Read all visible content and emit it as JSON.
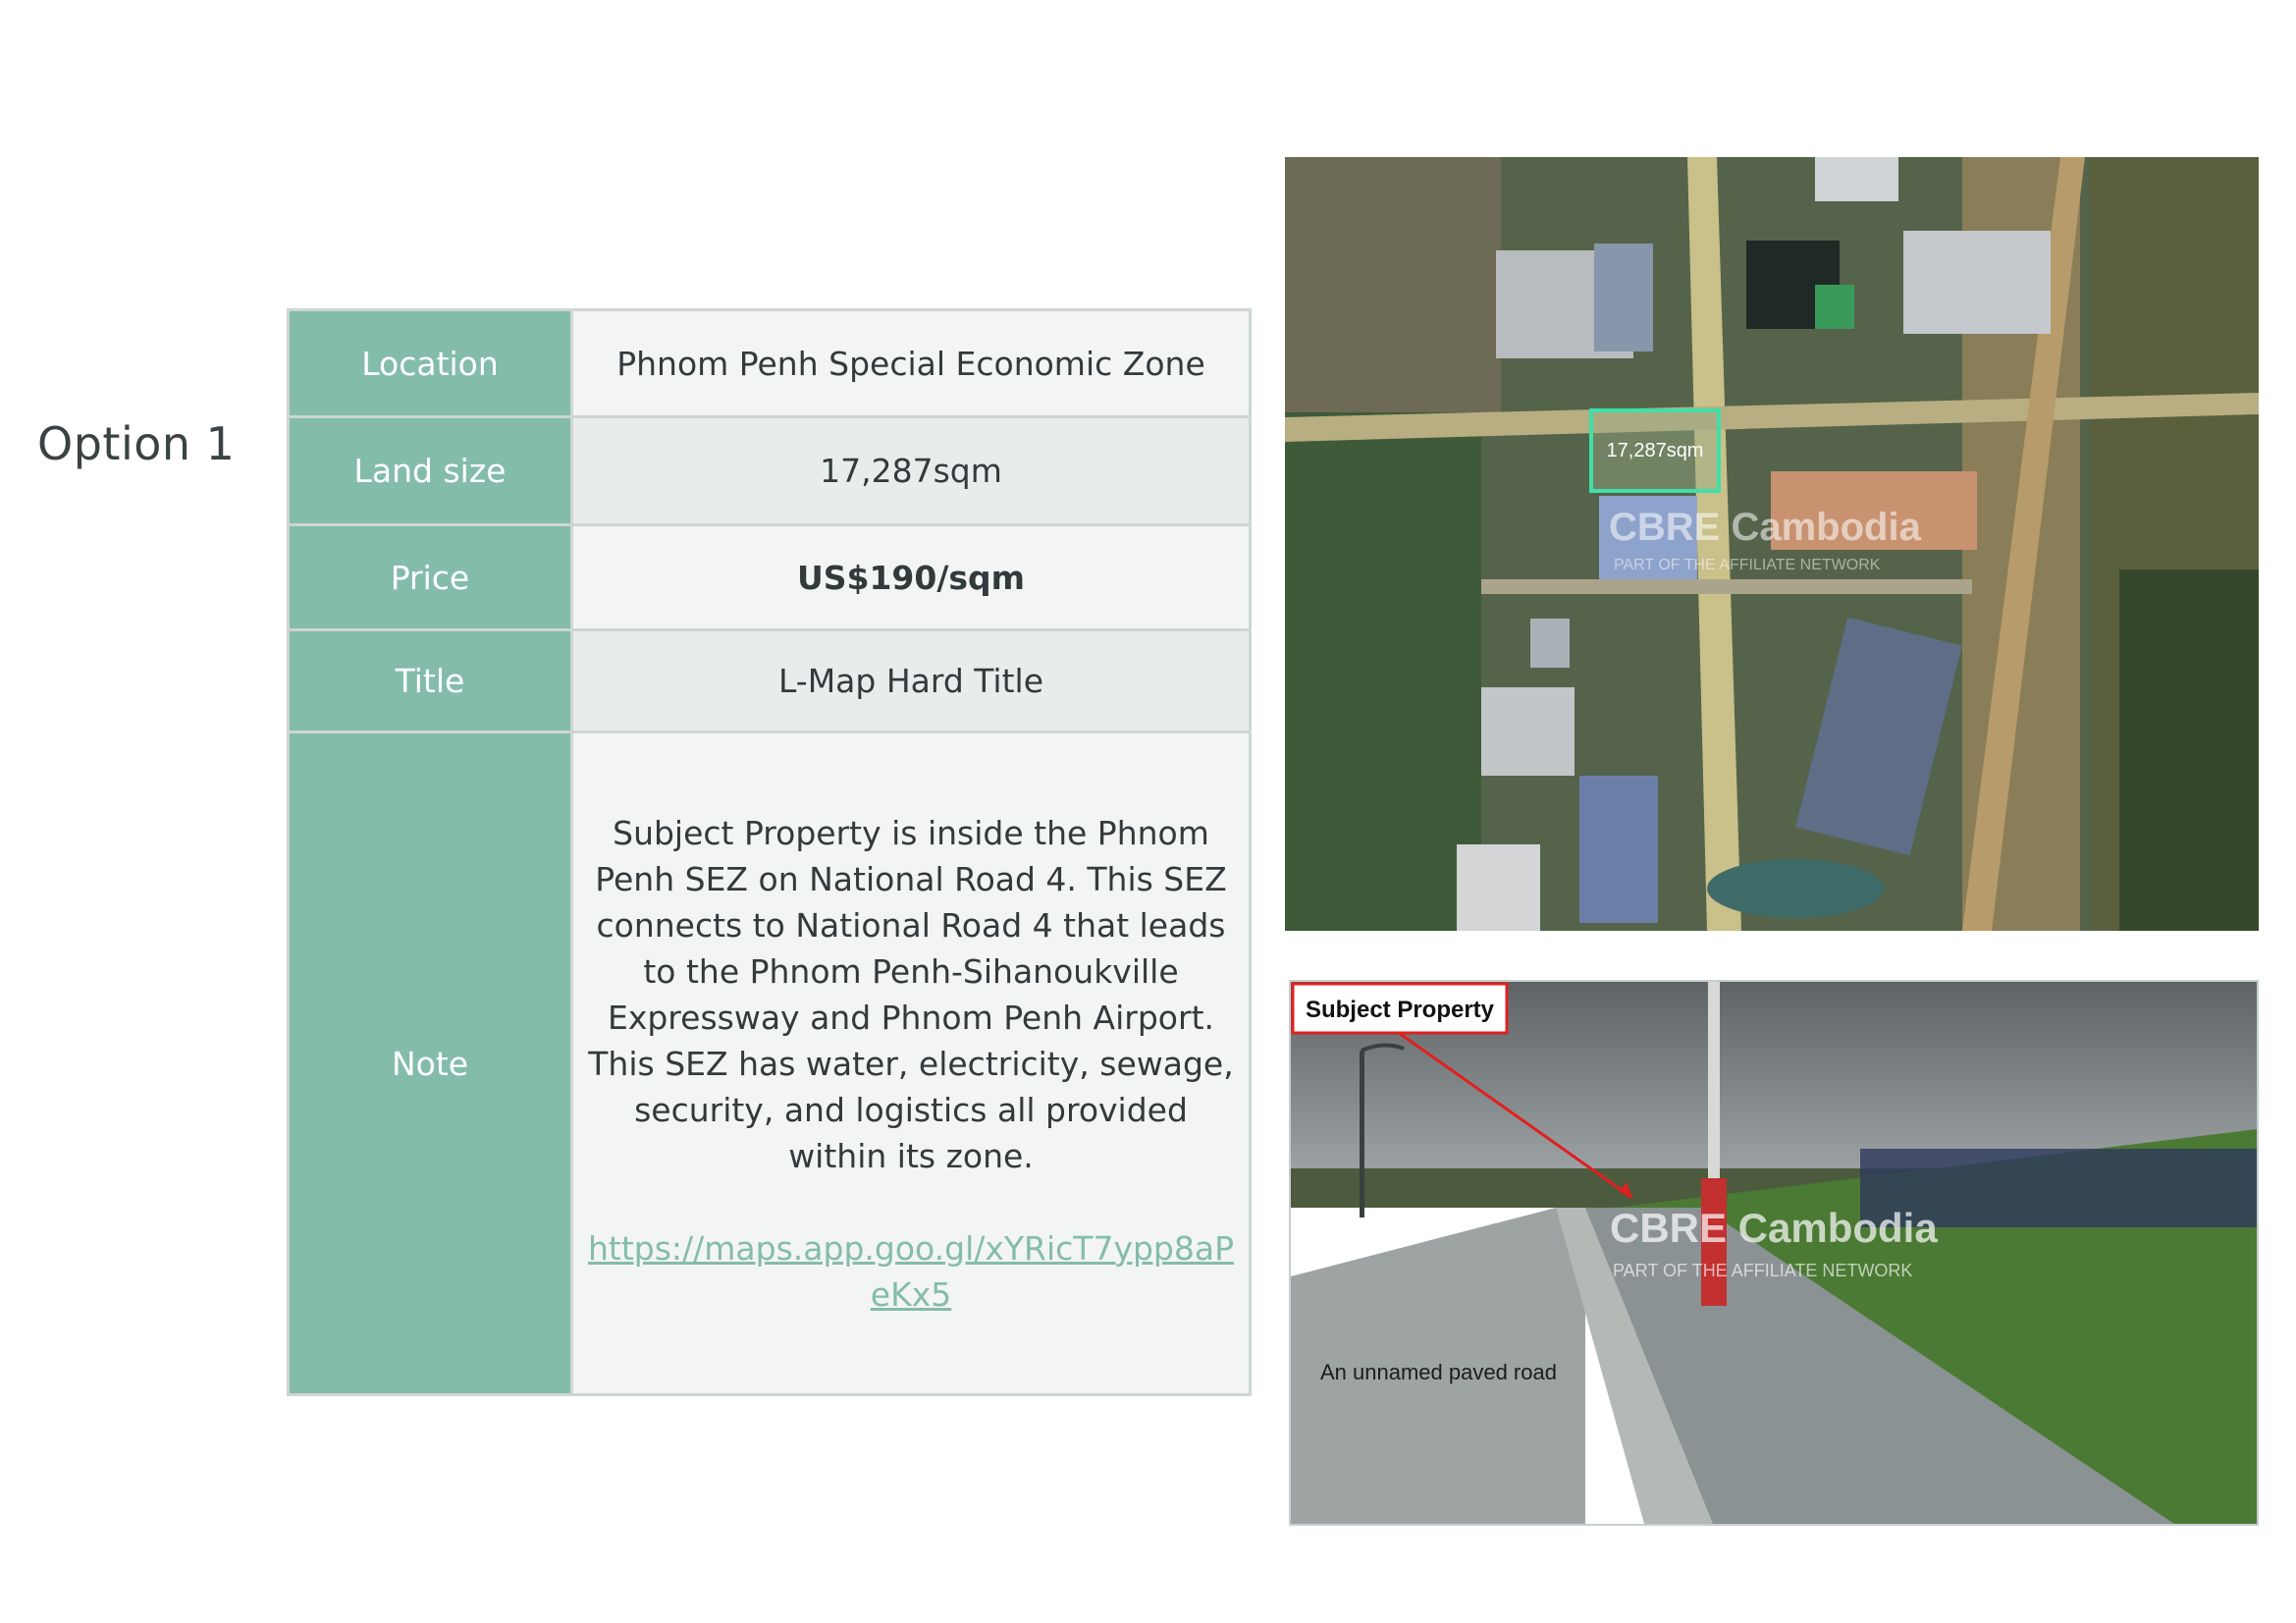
{
  "page": {
    "option_title": "Option 1"
  },
  "table": {
    "rows": [
      {
        "label": "Location",
        "value": "Phnom Penh Special Economic Zone"
      },
      {
        "label": "Land size",
        "value": "17,287sqm"
      },
      {
        "label": "Price",
        "value": "US$190/sqm"
      },
      {
        "label": "Title",
        "value": "L-Map Hard Title"
      }
    ],
    "note": {
      "label": "Note",
      "text": "Subject Property is inside the Phnom Penh SEZ on National Road 4. This SEZ connects to National Road 4 that leads to the Phnom Penh-Sihanoukville Expressway and Phnom Penh Airport. This SEZ has water, electricity, sewage, security, and logistics all provided within its zone.",
      "link": "https://maps.app.goo.gl/xYRicT7ypp8aPeKx5"
    }
  },
  "satellite_map": {
    "plot_label": "17,287sqm",
    "watermark_brand": "CBRE Cambodia",
    "watermark_tagline": "PART OF THE AFFILIATE NETWORK"
  },
  "site_photo": {
    "callout_label": "Subject Property",
    "road_caption": "An unnamed paved road",
    "watermark_brand": "CBRE Cambodia",
    "watermark_tagline": "PART OF THE AFFILIATE NETWORK"
  },
  "colors": {
    "label_cell_bg": "#84bcab",
    "link": "#84bcab",
    "table_border": "#cfd5d6",
    "callout_red": "#e02020",
    "plot_outline": "#3fe0a8"
  }
}
